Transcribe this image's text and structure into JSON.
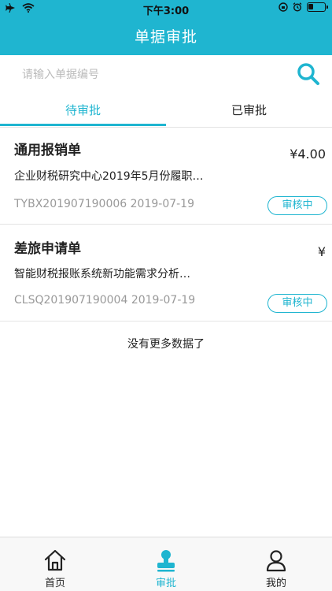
{
  "status_bar": {
    "time": "下午3:00"
  },
  "header": {
    "title": "单据审批"
  },
  "search": {
    "placeholder": "请输入单据编号",
    "value": ""
  },
  "tabs": [
    {
      "label": "待审批",
      "active": true
    },
    {
      "label": "已审批",
      "active": false
    }
  ],
  "list": {
    "items": [
      {
        "title": "通用报销单",
        "amount": "¥4.00",
        "description": "企业财税研究中心2019年5月份履职…",
        "meta": "TYBX201907190006  2019-07-19",
        "status": "审核中"
      },
      {
        "title": "差旅申请单",
        "amount": "¥",
        "description": "智能财税报账系统新功能需求分析…",
        "meta": "CLSQ201907190004  2019-07-19",
        "status": "审核中"
      }
    ],
    "end_text": "没有更多数据了"
  },
  "tabbar": {
    "items": [
      {
        "label": "首页",
        "icon": "home-icon",
        "active": false
      },
      {
        "label": "审批",
        "icon": "stamp-icon",
        "active": true
      },
      {
        "label": "我的",
        "icon": "user-icon",
        "active": false
      }
    ]
  },
  "colors": {
    "accent": "#1fb5d0",
    "text": "#222222",
    "muted": "#999999",
    "divider": "#e4e4e4"
  }
}
